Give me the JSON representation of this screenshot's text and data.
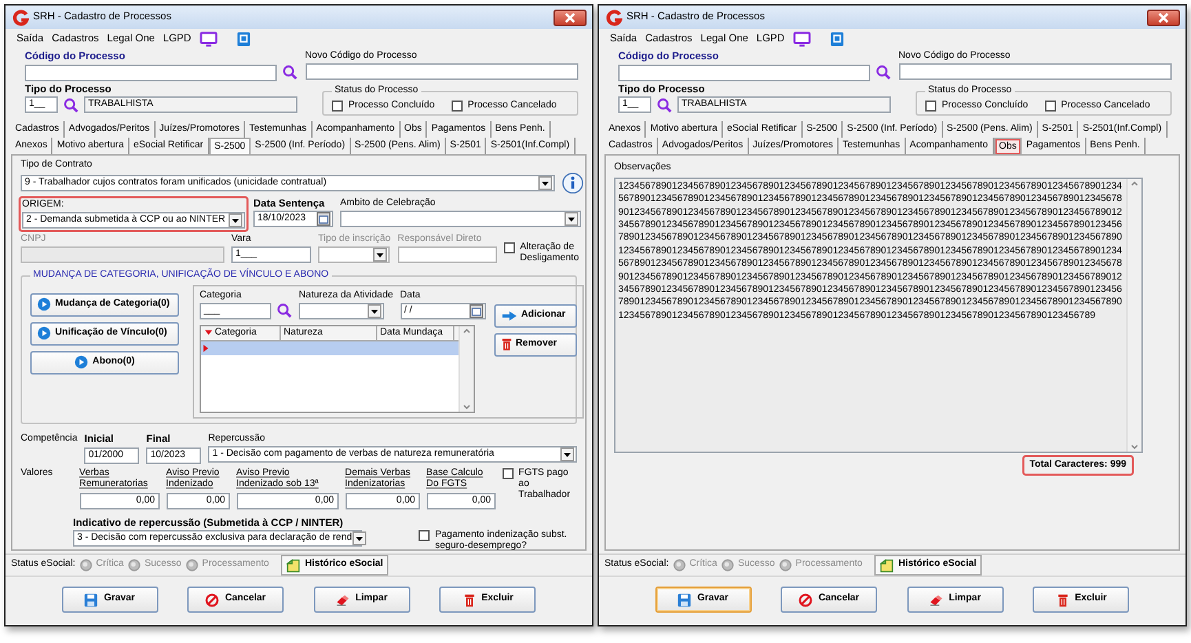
{
  "windows": [
    {
      "title": "SRH - Cadastro de Processos",
      "menu": [
        "Saída",
        "Cadastros",
        "Legal One",
        "LGPD"
      ],
      "codigo": {
        "label": "Código do Processo"
      },
      "novo_codigo": {
        "label": "Novo Código do Processo"
      },
      "tipo": {
        "label": "Tipo do Processo",
        "code": "1__",
        "name": "TRABALHISTA"
      },
      "status": {
        "label": "Status do Processo",
        "options": [
          {
            "label": "Processo Concluído",
            "checked": false
          },
          {
            "label": "Processo Cancelado",
            "checked": false
          }
        ]
      },
      "tab_rows": [
        [
          {
            "label": "Cadastros",
            "selected": false,
            "highlighted": false
          },
          {
            "label": "Advogados/Peritos",
            "selected": false,
            "highlighted": false
          },
          {
            "label": "Juízes/Promotores",
            "selected": false,
            "highlighted": false
          },
          {
            "label": "Testemunhas",
            "selected": false,
            "highlighted": false
          },
          {
            "label": "Acompanhamento",
            "selected": false,
            "highlighted": false
          },
          {
            "label": "Obs",
            "selected": false,
            "highlighted": false
          },
          {
            "label": "Pagamentos",
            "selected": false,
            "highlighted": false
          },
          {
            "label": "Bens Penh.",
            "selected": false,
            "highlighted": false
          }
        ],
        [
          {
            "label": "Anexos",
            "selected": false,
            "highlighted": false
          },
          {
            "label": "Motivo abertura",
            "selected": false,
            "highlighted": false
          },
          {
            "label": "eSocial Retificar",
            "selected": false,
            "highlighted": false
          },
          {
            "label": "S-2500",
            "selected": true,
            "highlighted": false
          },
          {
            "label": "S-2500 (Inf. Período)",
            "selected": false,
            "highlighted": false
          },
          {
            "label": "S-2500 (Pens. Alim)",
            "selected": false,
            "highlighted": false
          },
          {
            "label": "S-2501",
            "selected": false,
            "highlighted": false
          },
          {
            "label": "S-2501(Inf.Compl)",
            "selected": false,
            "highlighted": false
          }
        ]
      ],
      "panel": {
        "kind": "s2500",
        "tipo_contrato": {
          "label": "Tipo de Contrato",
          "value": "9 - Trabalhador cujos contratos foram unificados (unicidade contratual)"
        },
        "origem": {
          "label": "ORIGEM:",
          "value": "2 - Demanda submetida à CCP ou ao NINTER",
          "highlighted": true
        },
        "data_sentenca": {
          "label": "Data Sentença",
          "value": "18/10/2023"
        },
        "ambito": {
          "label": "Ambito de Celebração"
        },
        "cnpj": {
          "label": "CNPJ",
          "disabled": true
        },
        "vara": {
          "label": "Vara",
          "value": "1___"
        },
        "tipo_inscricao": {
          "label": "Tipo de inscrição",
          "disabled": true
        },
        "responsavel": {
          "label": "Responsável Direto",
          "disabled": true
        },
        "alteracao": {
          "label": "Alteração de Desligamento",
          "checked": false
        },
        "group": {
          "title": "MUDANÇA DE CATEGORIA, UNIFICAÇÃO DE VÍNCULO E ABONO",
          "side_buttons": [
            "Mudança de Categoria(0)",
            "Unificação de Vínculo(0)",
            "Abono(0)"
          ],
          "categoria": {
            "label": "Categoria",
            "value": "___"
          },
          "natureza": {
            "label": "Natureza da Atividade"
          },
          "data": {
            "label": "Data",
            "value": " / /"
          },
          "add": "Adicionar",
          "remove": "Remover",
          "grid": {
            "columns": [
              "Categoria",
              "Natureza",
              "Data Mundaça"
            ],
            "rows": [
              {
                "selected": true
              }
            ]
          }
        },
        "competencia": {
          "label": "Competência",
          "inicial": {
            "label": "Inicial",
            "value": "01/2000"
          },
          "final": {
            "label": "Final",
            "value": "10/2023"
          },
          "repercussao": {
            "label": "Repercussão",
            "value": "1 - Decisão com pagamento de verbas de natureza remuneratória"
          }
        },
        "valores": {
          "label": "Valores",
          "fields": [
            {
              "label": "Verbas Remuneratorias",
              "value": "0,00"
            },
            {
              "label": "Aviso Previo Indenizado",
              "value": "0,00"
            },
            {
              "label": "Aviso Previo Indenizado sob 13ª",
              "value": "0,00"
            },
            {
              "label": "Demais Verbas Indenizatorias",
              "value": "0,00"
            },
            {
              "label": "Base Calculo Do FGTS",
              "value": "0,00"
            }
          ],
          "fgts": {
            "label": "FGTS pago ao Trabalhador",
            "checked": false
          }
        },
        "indicativo": {
          "label": "Indicativo de repercussão (Submetida à CCP / NINTER)",
          "value": "3 - Decisão com repercussão exclusiva para declaração de rend"
        },
        "pagamento": {
          "label": "Pagamento indenização subst. seguro-desemprego?",
          "checked": false
        }
      },
      "status_bar": {
        "label": "Status eSocial:",
        "radios": [
          {
            "label": "Crítica",
            "disabled": true
          },
          {
            "label": "Sucesso",
            "disabled": true
          },
          {
            "label": "Processamento",
            "disabled": true
          }
        ],
        "history": "Histórico eSocial"
      },
      "buttons": [
        {
          "label": "Gravar",
          "kind": "save",
          "focused": false
        },
        {
          "label": "Cancelar",
          "kind": "cancel",
          "focused": false
        },
        {
          "label": "Limpar",
          "kind": "clear",
          "focused": false
        },
        {
          "label": "Excluir",
          "kind": "delete",
          "focused": false
        }
      ]
    },
    {
      "title": "SRH - Cadastro de Processos",
      "menu": [
        "Saída",
        "Cadastros",
        "Legal One",
        "LGPD"
      ],
      "codigo": {
        "label": "Código do Processo"
      },
      "novo_codigo": {
        "label": "Novo Código do Processo"
      },
      "tipo": {
        "label": "Tipo do Processo",
        "code": "1__",
        "name": "TRABALHISTA"
      },
      "status": {
        "label": "Status do Processo",
        "options": [
          {
            "label": "Processo Concluído",
            "checked": false
          },
          {
            "label": "Processo Cancelado",
            "checked": false
          }
        ]
      },
      "tab_rows": [
        [
          {
            "label": "Anexos",
            "selected": false,
            "highlighted": false
          },
          {
            "label": "Motivo abertura",
            "selected": false,
            "highlighted": false
          },
          {
            "label": "eSocial Retificar",
            "selected": false,
            "highlighted": false
          },
          {
            "label": "S-2500",
            "selected": false,
            "highlighted": false
          },
          {
            "label": "S-2500 (Inf. Período)",
            "selected": false,
            "highlighted": false
          },
          {
            "label": "S-2500 (Pens. Alim)",
            "selected": false,
            "highlighted": false
          },
          {
            "label": "S-2501",
            "selected": false,
            "highlighted": false
          },
          {
            "label": "S-2501(Inf.Compl)",
            "selected": false,
            "highlighted": false
          }
        ],
        [
          {
            "label": "Cadastros",
            "selected": false,
            "highlighted": false
          },
          {
            "label": "Advogados/Peritos",
            "selected": false,
            "highlighted": false
          },
          {
            "label": "Juízes/Promotores",
            "selected": false,
            "highlighted": false
          },
          {
            "label": "Testemunhas",
            "selected": false,
            "highlighted": false
          },
          {
            "label": "Acompanhamento",
            "selected": false,
            "highlighted": false
          },
          {
            "label": "Obs",
            "selected": true,
            "highlighted": true
          },
          {
            "label": "Pagamentos",
            "selected": false,
            "highlighted": false
          },
          {
            "label": "Bens Penh.",
            "selected": false,
            "highlighted": false
          }
        ]
      ],
      "panel": {
        "kind": "obs",
        "label": "Observações",
        "value": "123456789012345678901234567890123456789012345678901234567890123456789012345678901234567890123456789012345678901234567890123456789012345678901234567890123456789012345678901234567890123456789012345678901234567890123456789012345678901234567890123456789012345678901234567890123456789012345678901234567890123456789012345678901234567890123456789012345678901234567890123456789012345678901234567890123456789012345678901234567890123456789012345678901234567890123456789012345678901234567890123456789012345678901234567890123456789012345678901234567890123456789012345678901234567890123456789012345678901234567890123456789012345678901234567890123456789012345678901234567890123456789012345678901234567890123456789012345678901234567890123456789012345678901234567890123456789012345678901234567890123456789012345678901234567890123456789012345678901234567890123456789012345678901234567890123456789012345678901234567890123456789012345678901234567890123456789012345678901234567890123456789012345678901234567890123456789012345678901234567890123456789",
        "total": {
          "label": "Total Caracteres:",
          "value": "999",
          "highlighted": true
        }
      },
      "status_bar": {
        "label": "Status eSocial:",
        "radios": [
          {
            "label": "Crítica",
            "disabled": true
          },
          {
            "label": "Sucesso",
            "disabled": true
          },
          {
            "label": "Processamento",
            "disabled": true
          }
        ],
        "history": "Histórico eSocial"
      },
      "buttons": [
        {
          "label": "Gravar",
          "kind": "save",
          "focused": true
        },
        {
          "label": "Cancelar",
          "kind": "cancel",
          "focused": false
        },
        {
          "label": "Limpar",
          "kind": "clear",
          "focused": false
        },
        {
          "label": "Excluir",
          "kind": "delete",
          "focused": false
        }
      ]
    }
  ]
}
